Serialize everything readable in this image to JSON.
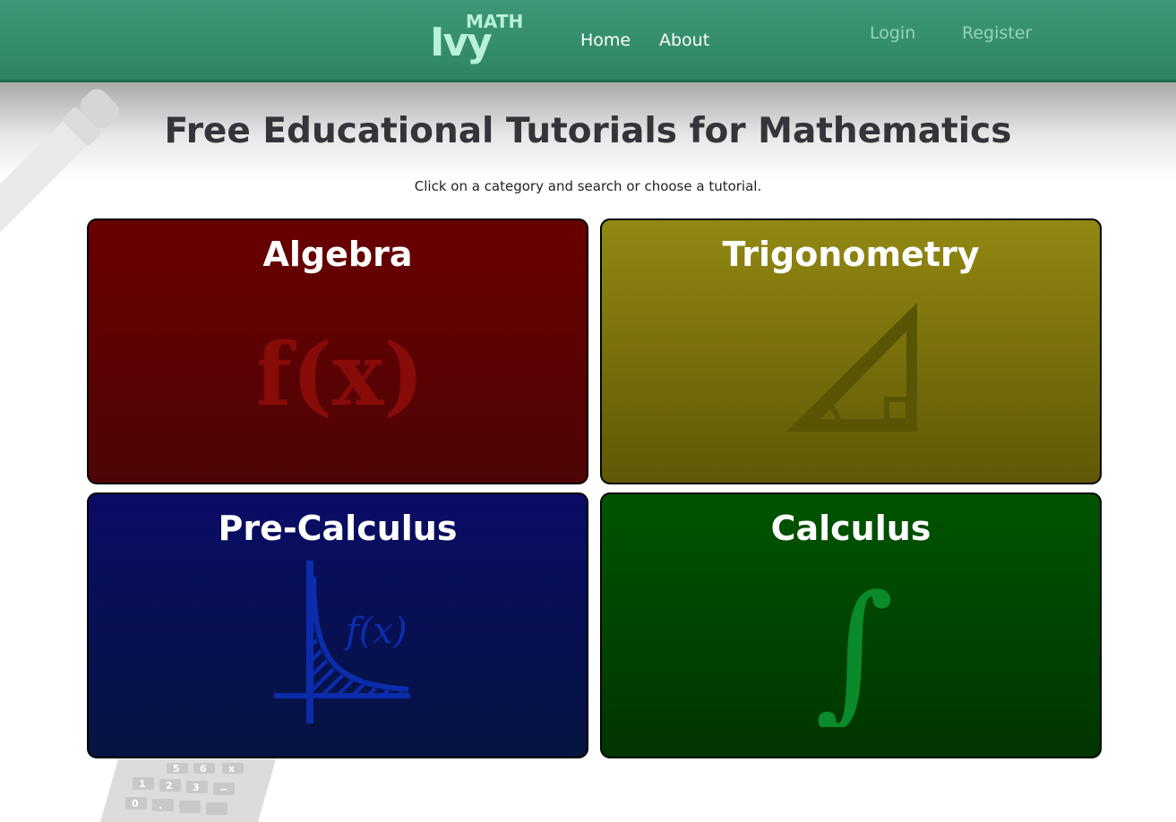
{
  "header": {
    "logo_main": "Ivy",
    "logo_super": "MATH",
    "nav": {
      "home": "Home",
      "about": "About"
    },
    "auth": {
      "login": "Login",
      "register": "Register"
    }
  },
  "main": {
    "title": "Free Educational Tutorials for Mathematics",
    "subtitle": "Click on a category and search or choose a tutorial."
  },
  "categories": [
    {
      "label": "Algebra",
      "icon": "fx-icon",
      "symbol": "f(x)",
      "color": "#690000"
    },
    {
      "label": "Trigonometry",
      "icon": "triangle-icon",
      "color": "#928812"
    },
    {
      "label": "Pre-Calculus",
      "icon": "function-graph-icon",
      "symbol": "f(x)",
      "color": "#0a0c66"
    },
    {
      "label": "Calculus",
      "icon": "integral-icon",
      "symbol": "∫",
      "color": "#005400"
    }
  ],
  "calculator_keys": [
    "5",
    "6",
    "x",
    "1",
    "2",
    "3",
    "−",
    "0",
    "."
  ]
}
